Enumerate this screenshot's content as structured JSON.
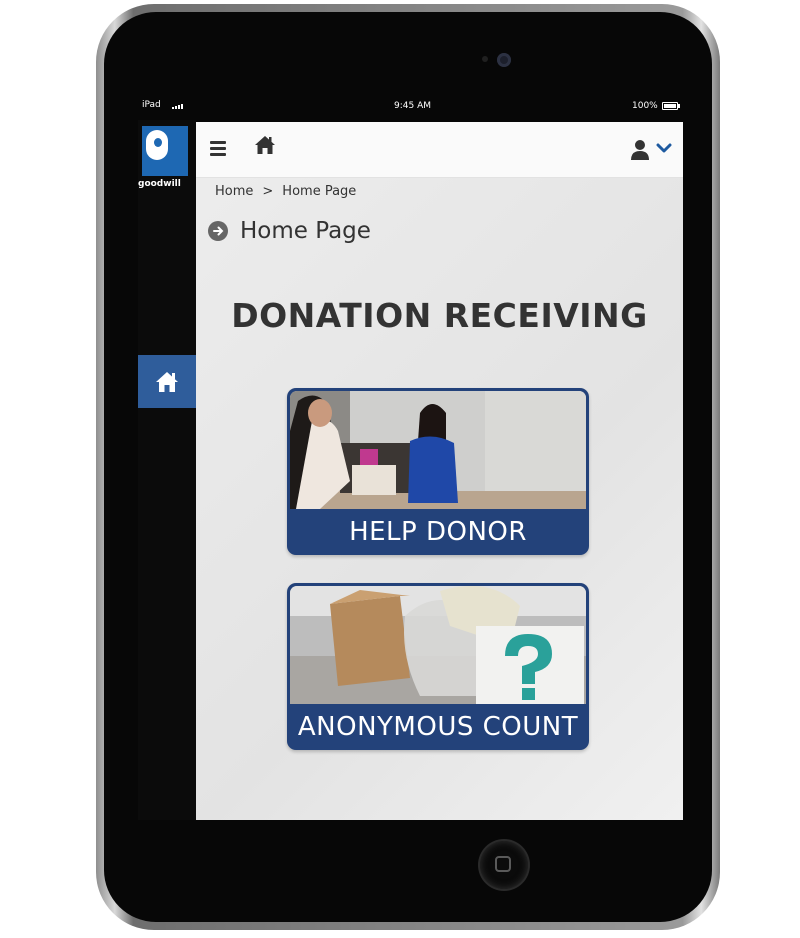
{
  "device": {
    "name": "iPad"
  },
  "status_bar": {
    "carrier": "iPad",
    "time": "9:45 AM",
    "battery": "100%"
  },
  "brand": {
    "wordmark": "goodwill",
    "color": "#1e68b3"
  },
  "sidebar": {
    "items": [
      {
        "icon": "home-icon",
        "active": true
      }
    ]
  },
  "topbar": {
    "menu_icon": "menu-icon",
    "home_icon": "home-icon",
    "user_icon": "user-icon",
    "dropdown_icon": "chevron-down-icon"
  },
  "breadcrumb": {
    "items": [
      "Home",
      "Home Page"
    ],
    "separator": ">"
  },
  "page": {
    "title": "Home Page",
    "heading": "DONATION RECEIVING"
  },
  "cards": [
    {
      "label": "HELP DONOR"
    },
    {
      "label": "ANONYMOUS COUNT"
    }
  ],
  "colors": {
    "accent": "#2f5d9b",
    "card": "#23427a"
  }
}
